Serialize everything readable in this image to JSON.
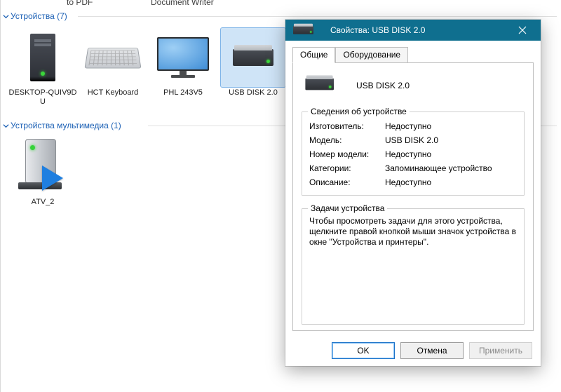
{
  "top_fragments": {
    "left": "to PDF",
    "right": "Document Writer"
  },
  "sections": {
    "devices_header": "Устройства (7)",
    "multimedia_header": "Устройства мультимедиа (1)"
  },
  "devices": [
    {
      "name": "DESKTOP-QUIV9DU",
      "icon": "tower-pc"
    },
    {
      "name": "HCT Keyboard",
      "icon": "keyboard"
    },
    {
      "name": "PHL 243V5",
      "icon": "monitor"
    },
    {
      "name": "USB DISK 2.0",
      "icon": "ext-drive",
      "selected": true
    }
  ],
  "multimedia": [
    {
      "name": "ATV_2",
      "icon": "media-device"
    }
  ],
  "dialog": {
    "title": "Свойства: USB DISK 2.0",
    "tabs": {
      "general": "Общие",
      "hardware": "Оборудование"
    },
    "device_name": "USB DISK 2.0",
    "info_group_title": "Сведения об устройстве",
    "rows": {
      "manufacturer_k": "Изготовитель:",
      "manufacturer_v": "Недоступно",
      "model_k": "Модель:",
      "model_v": "USB DISK 2.0",
      "modelno_k": "Номер модели:",
      "modelno_v": "Недоступно",
      "categories_k": "Категории:",
      "categories_v": "Запоминающее устройство",
      "description_k": "Описание:",
      "description_v": "Недоступно"
    },
    "tasks_group_title": "Задачи устройства",
    "tasks_text": "Чтобы просмотреть задачи для этого устройства, щелкните правой кнопкой мыши значок устройства в окне \"Устройства и принтеры\".",
    "buttons": {
      "ok": "OK",
      "cancel": "Отмена",
      "apply": "Применить"
    }
  }
}
